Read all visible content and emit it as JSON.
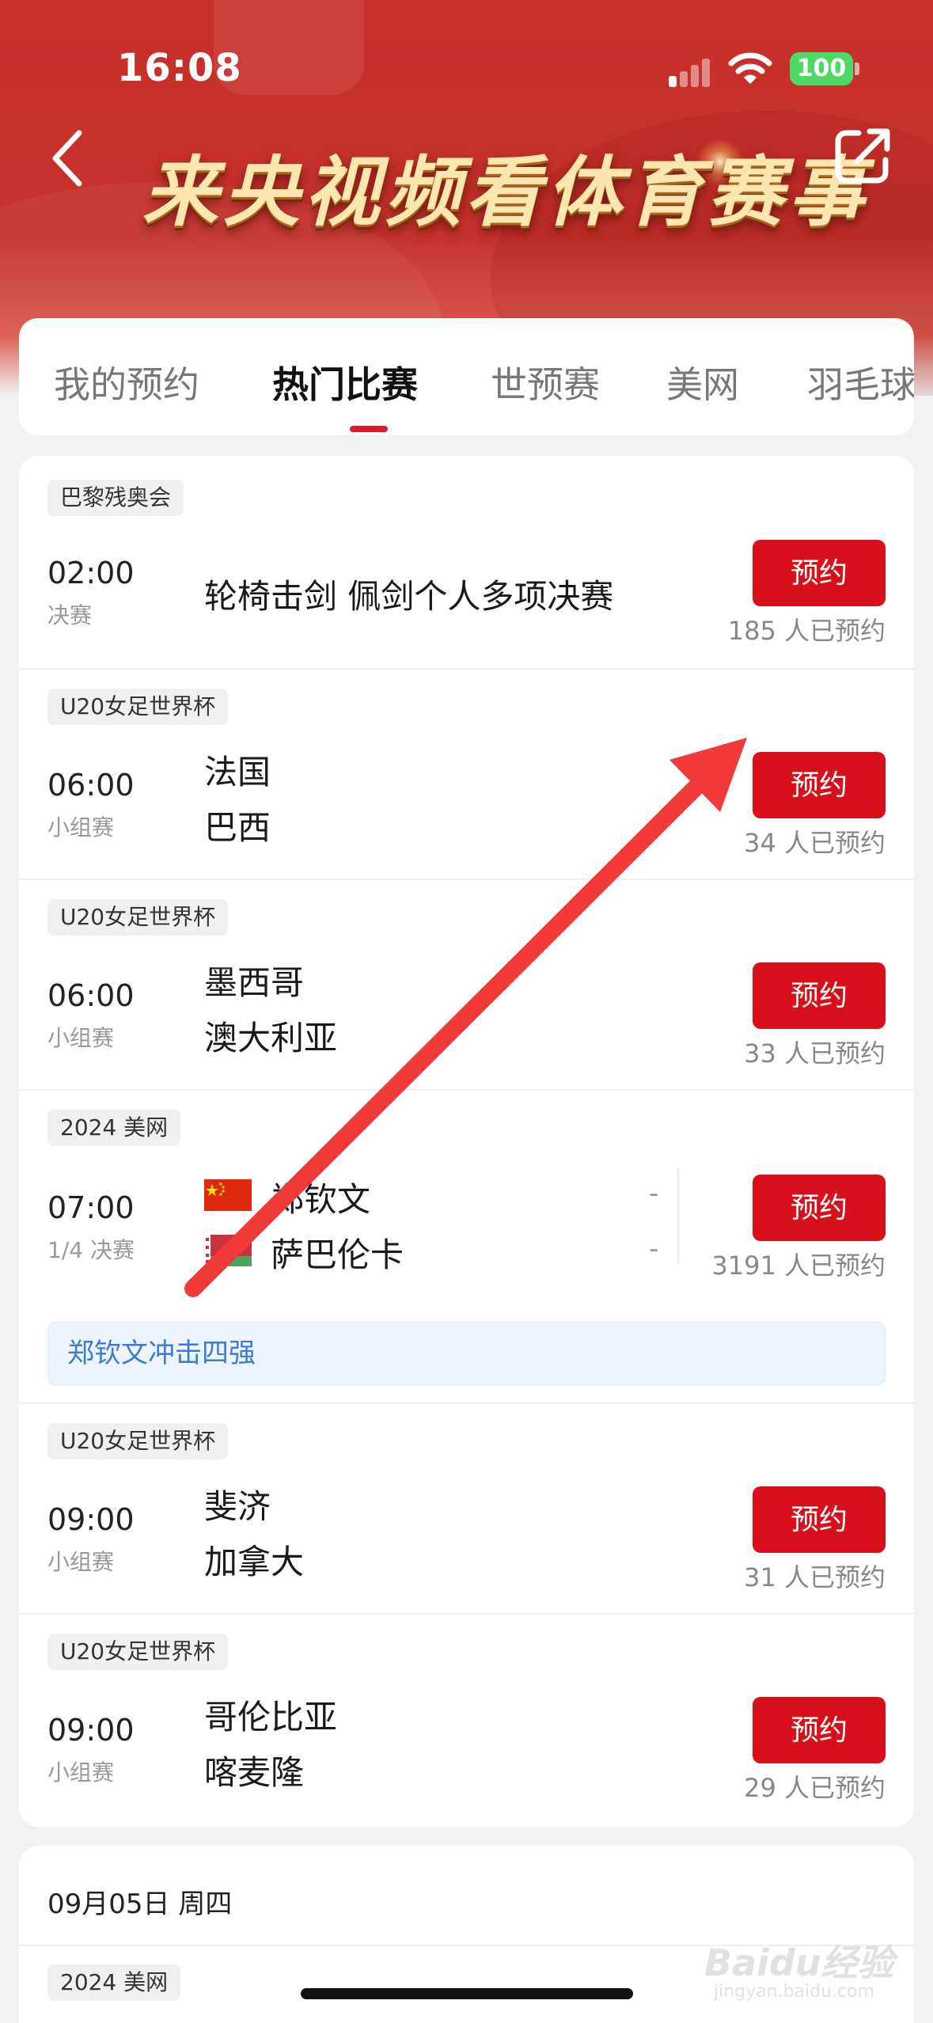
{
  "status_bar": {
    "time": "16:08",
    "battery": "100"
  },
  "header": {
    "title": "来央视频看体育赛事"
  },
  "tabs": [
    {
      "label": "我的预约"
    },
    {
      "label": "热门比赛"
    },
    {
      "label": "世预赛"
    },
    {
      "label": "美网"
    },
    {
      "label": "羽毛球"
    }
  ],
  "matches": [
    {
      "competition": "巴黎残奥会",
      "time": "02:00",
      "stage": "决赛",
      "title": "轮椅击剑 佩剑个人多项决赛",
      "button": "预约",
      "count": "185 人已预约"
    },
    {
      "competition": "U20女足世界杯",
      "time": "06:00",
      "stage": "小组赛",
      "team1": "法国",
      "team2": "巴西",
      "button": "预约",
      "count": "34 人已预约"
    },
    {
      "competition": "U20女足世界杯",
      "time": "06:00",
      "stage": "小组赛",
      "team1": "墨西哥",
      "team2": "澳大利亚",
      "button": "预约",
      "count": "33 人已预约"
    },
    {
      "competition": "2024 美网",
      "time": "07:00",
      "stage": "1/4 决赛",
      "team1": "郑钦文",
      "team2": "萨巴伦卡",
      "score1": "-",
      "score2": "-",
      "button": "预约",
      "count": "3191 人已预约",
      "note": "郑钦文冲击四强"
    },
    {
      "competition": "U20女足世界杯",
      "time": "09:00",
      "stage": "小组赛",
      "team1": "斐济",
      "team2": "加拿大",
      "button": "预约",
      "count": "31 人已预约"
    },
    {
      "competition": "U20女足世界杯",
      "time": "09:00",
      "stage": "小组赛",
      "team1": "哥伦比亚",
      "team2": "喀麦隆",
      "button": "预约",
      "count": "29 人已预约"
    }
  ],
  "next_day": {
    "date": "09月05日 周四",
    "competition": "2024 美网"
  },
  "watermark": {
    "text": "Baidu经验",
    "sub": "jingyan.baidu.com"
  },
  "colors": {
    "brand_red": "#d8101c",
    "header_red": "#c8302a",
    "note_blue": "#3a7bd5"
  },
  "icons": [
    "back-chevron-icon",
    "share-icon",
    "signal-icon",
    "wifi-icon",
    "china-flag-icon",
    "belarus-flag-icon"
  ]
}
